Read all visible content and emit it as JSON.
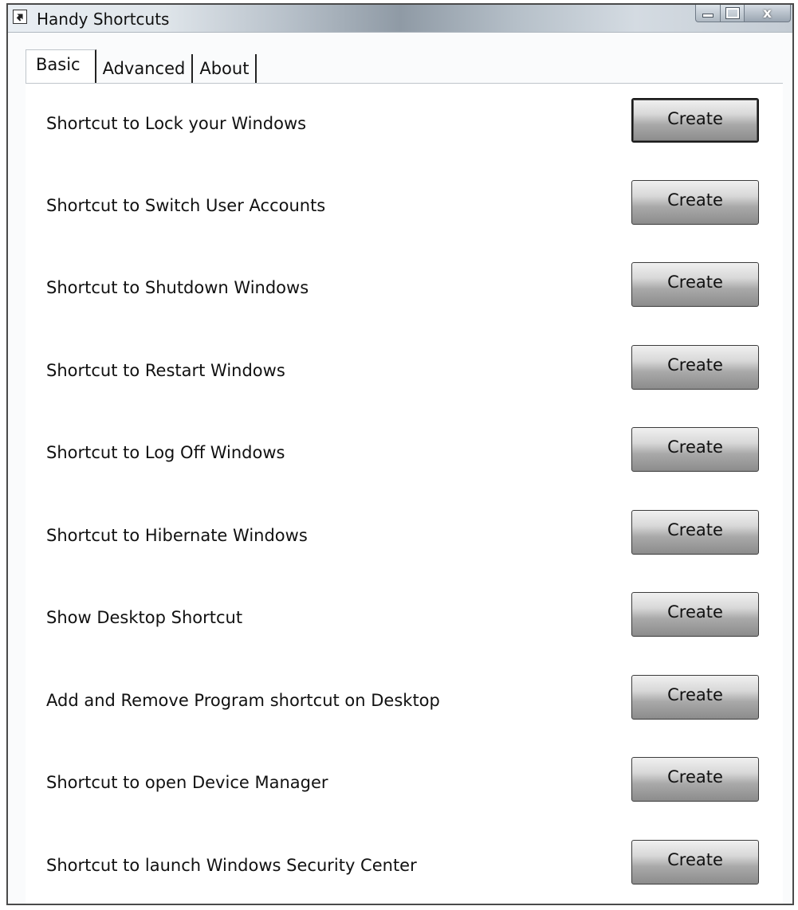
{
  "window": {
    "title": "Handy Shortcuts",
    "icon": "shortcut-arrow-icon",
    "controls": {
      "minimize": "minimize-icon",
      "maximize": "maximize-icon",
      "close_label": "x"
    }
  },
  "tabs": [
    {
      "label": "Basic",
      "selected": true
    },
    {
      "label": "Advanced",
      "selected": false
    },
    {
      "label": "About",
      "selected": false
    }
  ],
  "shortcuts": [
    {
      "label": "Shortcut to Lock your Windows",
      "button": "Create"
    },
    {
      "label": "Shortcut to Switch User Accounts",
      "button": "Create"
    },
    {
      "label": "Shortcut to Shutdown Windows",
      "button": "Create"
    },
    {
      "label": "Shortcut to Restart Windows",
      "button": "Create"
    },
    {
      "label": "Shortcut to Log Off Windows",
      "button": "Create"
    },
    {
      "label": "Shortcut to Hibernate Windows",
      "button": "Create"
    },
    {
      "label": "Show Desktop Shortcut",
      "button": "Create"
    },
    {
      "label": "Add and Remove Program shortcut on Desktop",
      "button": "Create"
    },
    {
      "label": "Shortcut to open Device Manager",
      "button": "Create"
    },
    {
      "label": "Shortcut to launch Windows Security Center",
      "button": "Create"
    }
  ]
}
